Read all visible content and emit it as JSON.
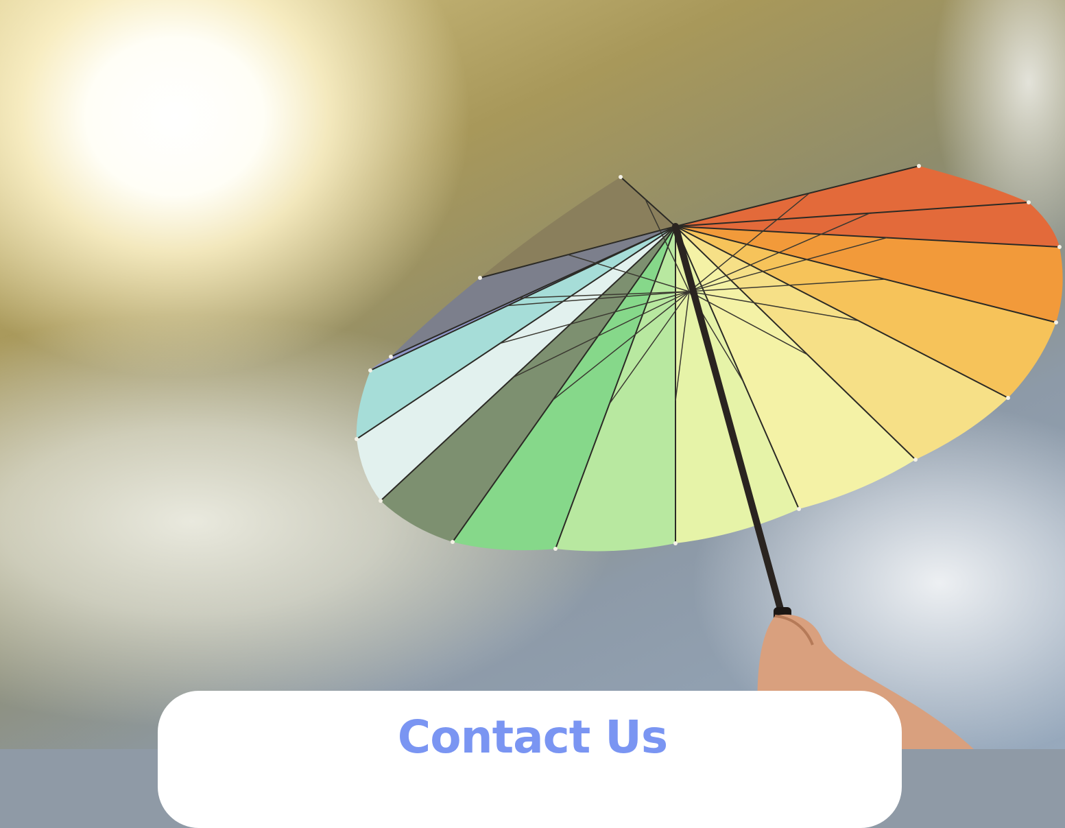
{
  "hero": {
    "image_description_icon": "umbrella-under-sun-photo",
    "colors": {
      "sun": "#fffef6",
      "sky": "#97a9bd",
      "umbrella_panels": [
        "#e36a3a",
        "#e36a3a",
        "#f29a3a",
        "#f6c35a",
        "#f6e087",
        "#f4f2a6",
        "#e6f3a8",
        "#b8e8a0",
        "#86d88a",
        "#7d9070",
        "#e2f1ee",
        "#a6ddd8",
        "#8f96c8",
        "#7c7f8c",
        "#8a7f5c"
      ]
    }
  },
  "contact": {
    "title": "Contact Us",
    "accent": "#7a95f2"
  }
}
